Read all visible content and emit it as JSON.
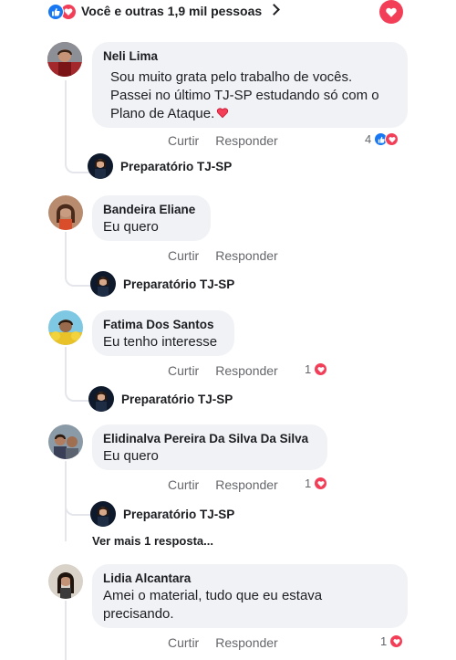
{
  "top": {
    "reactions_text": "Você e outras 1,9 mil pessoas"
  },
  "colors": {
    "like": "#1877f2",
    "love": "#f33e58",
    "bubble": "#f0f2f5",
    "muted": "#65676b"
  },
  "labels": {
    "like": "Curtir",
    "reply": "Responder"
  },
  "page_reply_name": "Preparatório TJ-SP",
  "comments": [
    {
      "author": "Neli Lima",
      "lines": [
        "Sou muito grata pelo trabalho de vocês.",
        "Passei no último TJ-SP estudando só com o",
        "Plano de Ataque."
      ],
      "reaction_count": "4",
      "reactions": [
        "like-icon",
        "heart-icon"
      ]
    },
    {
      "author": "Bandeira Eliane",
      "lines": [
        "Eu quero"
      ]
    },
    {
      "author": "Fatima Dos Santos",
      "lines": [
        "Eu tenho interesse"
      ],
      "reaction_count": "1",
      "reactions": [
        "heart-icon"
      ]
    },
    {
      "author": "Elidinalva Pereira Da Silva Da Silva",
      "lines": [
        "Eu quero"
      ],
      "reaction_count": "1",
      "reactions": [
        "heart-icon"
      ]
    },
    {
      "author": "Lidia Alcantara",
      "lines": [
        "Amei o material, tudo que eu estava",
        "precisando."
      ],
      "reaction_count": "1",
      "reactions": [
        "heart-icon"
      ]
    }
  ],
  "more_replies": "Ver mais 1 resposta..."
}
